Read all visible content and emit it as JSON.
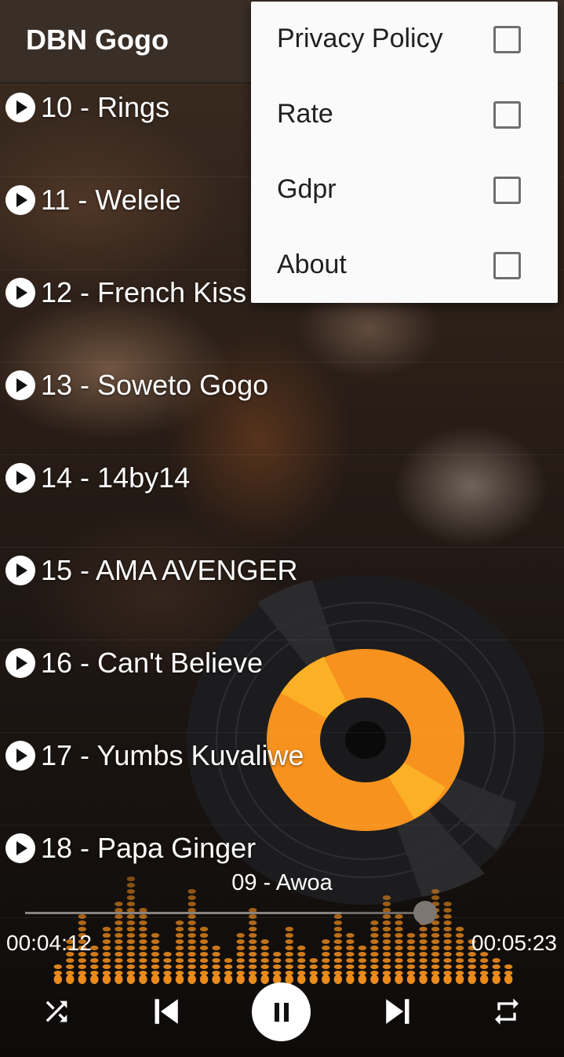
{
  "app": {
    "title": "DBN Gogo"
  },
  "tracks": [
    {
      "label": "10 - Rings"
    },
    {
      "label": "11 - Welele"
    },
    {
      "label": "12 - French Kiss"
    },
    {
      "label": "13 - Soweto Gogo"
    },
    {
      "label": "14 - 14by14"
    },
    {
      "label": "15 - AMA AVENGER"
    },
    {
      "label": "16 - Can't Believe"
    },
    {
      "label": "17 - Yumbs Kuvaliwe"
    },
    {
      "label": "18 - Papa Ginger"
    }
  ],
  "menu": {
    "items": [
      {
        "label": "Privacy Policy",
        "checked": false
      },
      {
        "label": "Rate",
        "checked": false
      },
      {
        "label": "Gdpr",
        "checked": false
      },
      {
        "label": "About",
        "checked": false
      }
    ]
  },
  "player": {
    "now_playing": "09 - Awoa",
    "elapsed": "00:04:12",
    "total": "00:05:23",
    "progress": 0.79,
    "state": "playing",
    "accent_color": "#f7921e",
    "controls": [
      "shuffle-icon",
      "skip-previous-icon",
      "pause-icon",
      "skip-next-icon",
      "repeat-icon"
    ]
  }
}
